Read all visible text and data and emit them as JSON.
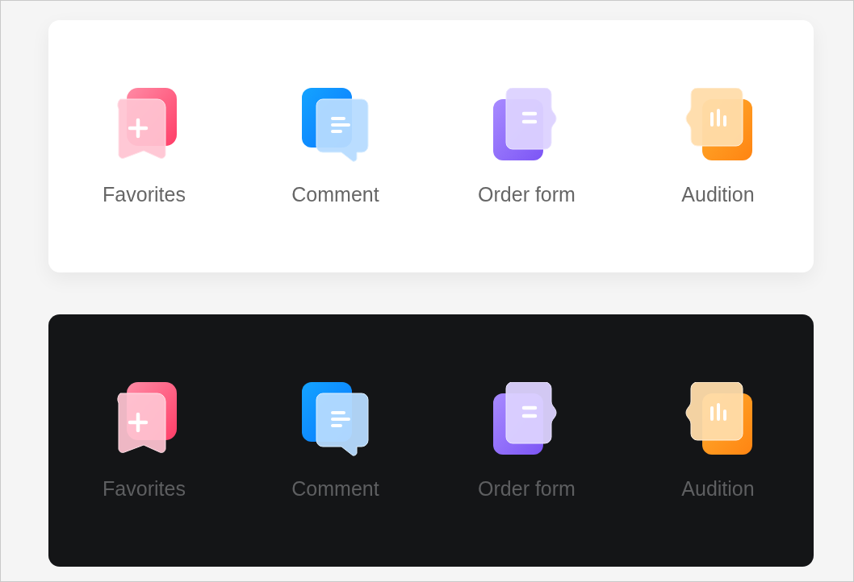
{
  "panels": [
    {
      "dark": false,
      "items": [
        {
          "kind": "favorites",
          "label": "Favorites"
        },
        {
          "kind": "comment",
          "label": "Comment"
        },
        {
          "kind": "order",
          "label": "Order form"
        },
        {
          "kind": "audition",
          "label": "Audition"
        }
      ]
    },
    {
      "dark": true,
      "items": [
        {
          "kind": "favorites",
          "label": "Favorites"
        },
        {
          "kind": "comment",
          "label": "Comment"
        },
        {
          "kind": "order",
          "label": "Order form"
        },
        {
          "kind": "audition",
          "label": "Audition"
        }
      ]
    }
  ]
}
